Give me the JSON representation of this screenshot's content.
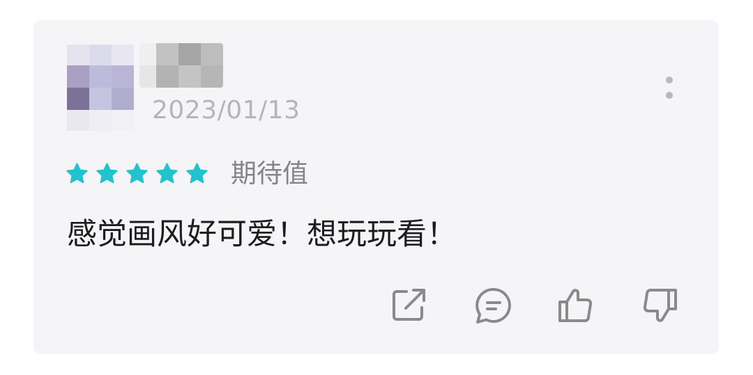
{
  "review": {
    "date": "2023/01/13",
    "rating": 5,
    "rating_max": 5,
    "rating_label": "期待值",
    "text": "感觉画风好可爱！想玩玩看！"
  },
  "icons": {
    "more": "more-vertical-icon",
    "star": "star-icon",
    "share": "share-icon",
    "comment": "comment-icon",
    "like": "thumbs-up-icon",
    "dislike": "thumbs-down-icon"
  },
  "colors": {
    "card_bg": "#f5f5f7",
    "star": "#22c3cf",
    "date": "#b5b5b5",
    "label": "#858585",
    "text": "#1d1d1d",
    "icon": "#8a8a8a"
  }
}
